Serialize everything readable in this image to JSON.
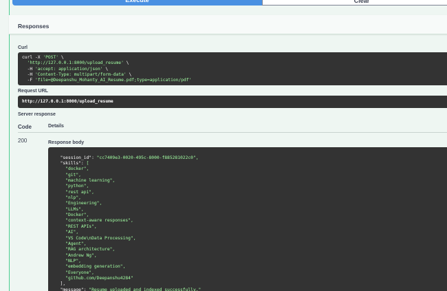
{
  "buttons": {
    "execute": "Execute",
    "clear": "Clear"
  },
  "responses": {
    "title": "Responses"
  },
  "curl": {
    "label": "Curl",
    "lines": [
      "curl -X 'POST' \\",
      "  'http://127.0.0.1:8000/upload_resume' \\",
      "  -H 'accept: application/json' \\",
      "  -H 'Content-Type: multipart/form-data' \\",
      "  -F 'file=@Deepanshu_Mohanty_AI_Resume.pdf;type=application/pdf'"
    ]
  },
  "request_url": {
    "label": "Request URL",
    "value": "http://127.0.0.1:8000/upload_resume"
  },
  "server_response": {
    "label": "Server response",
    "col_code": "Code",
    "col_details": "Details",
    "code": "200",
    "body_label": "Response body",
    "body_lines": [
      "  \"session_id\": \"cc7409e3-0020-495c-8000-f885281022c0\",",
      "  \"skills\": [",
      "    \"docker\",",
      "    \"git\",",
      "    \"machine learning\",",
      "    \"python\",",
      "    \"rest api\",",
      "    \"nlp\",",
      "    \"Engineering\",",
      "    \"LLMs\",",
      "    \"Docker\",",
      "    \"context-aware responses\",",
      "    \"REST APIs\",",
      "    \"AI\",",
      "    \"VS Code\\nData Processing\",",
      "    \"Agent\",",
      "    \"RAG architecture\",",
      "    \"Andrew Ng\",",
      "    \"NLP\",",
      "    \"embedding generation\",",
      "    \"Everyone\",",
      "    \"github.com/Deepanshu4284\"",
      "  ],",
      "  \"message\": \"Resume uploaded and indexed successfully.\"",
      "}"
    ]
  },
  "colors": {
    "accent_green": "#49cc90",
    "execute_blue": "#4990e2",
    "code_bg": "#333333",
    "string_green": "#a2fca2"
  }
}
